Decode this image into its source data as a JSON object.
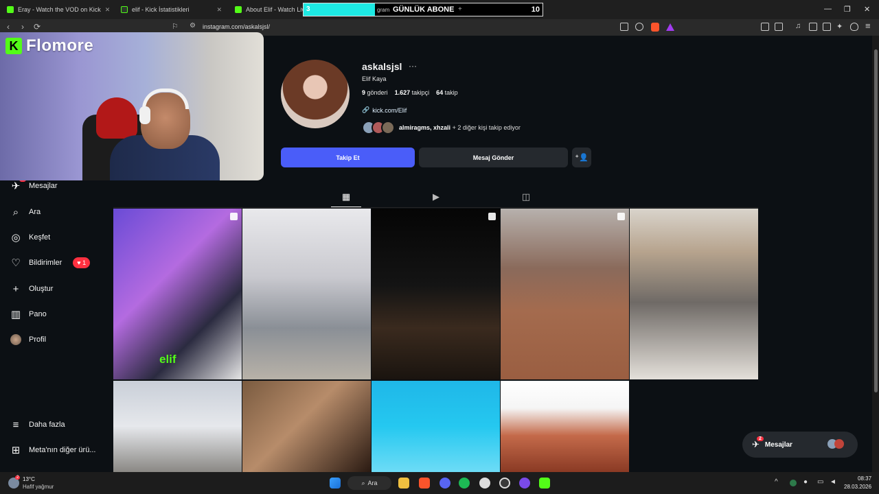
{
  "browser": {
    "tabs": [
      {
        "title": "Eray - Watch the VOD on Kick"
      },
      {
        "title": "elif - Kick İstatistikleri"
      },
      {
        "title": "About Elif - Watch Live o"
      }
    ],
    "tab_fragment": "gram",
    "url": "instagram.com/askalsjsl/"
  },
  "sub_goal": {
    "label": "GÜNLÜK ABONE",
    "current": "3",
    "target": "10",
    "progress": 0.3,
    "plus": "+"
  },
  "stream_overlay": {
    "brand": "Flomore",
    "kick_letter": "K",
    "streamer_tag": "elif"
  },
  "sidebar": {
    "items": [
      {
        "label": "Mesajlar",
        "badge": "2"
      },
      {
        "label": "Ara"
      },
      {
        "label": "Keşfet"
      },
      {
        "label": "Bildirimler",
        "badge": "1"
      },
      {
        "label": "Oluştur"
      },
      {
        "label": "Pano"
      },
      {
        "label": "Profil"
      }
    ],
    "more": "Daha fazla",
    "meta": "Meta'nın diğer ürü..."
  },
  "profile": {
    "username": "askalsjsl",
    "more_icon": "···",
    "full_name": "Elif Kaya",
    "posts_count": "9",
    "posts_label": "gönderi",
    "followers_count": "1.627",
    "followers_label": "takipçi",
    "following_count": "64",
    "following_label": "takip",
    "link": "kick.com/Elif",
    "followed_by_names": "almiragms, xhzali",
    "followed_by_rest": "+ 2 diğer kişi takip ediyor",
    "follow_button": "Takip Et",
    "message_button": "Mesaj Gönder"
  },
  "floating_messages": {
    "label": "Mesajlar",
    "badge": "2"
  },
  "taskbar": {
    "temperature": "13°C",
    "weather": "Hafif yağmur",
    "search": "Ara",
    "time": "08:37",
    "date": "28.03.2026"
  },
  "colors": {
    "accent": "#4a5df9",
    "kick_green": "#53fc18",
    "notification_red": "#ff3040",
    "background": "#0c1014"
  }
}
